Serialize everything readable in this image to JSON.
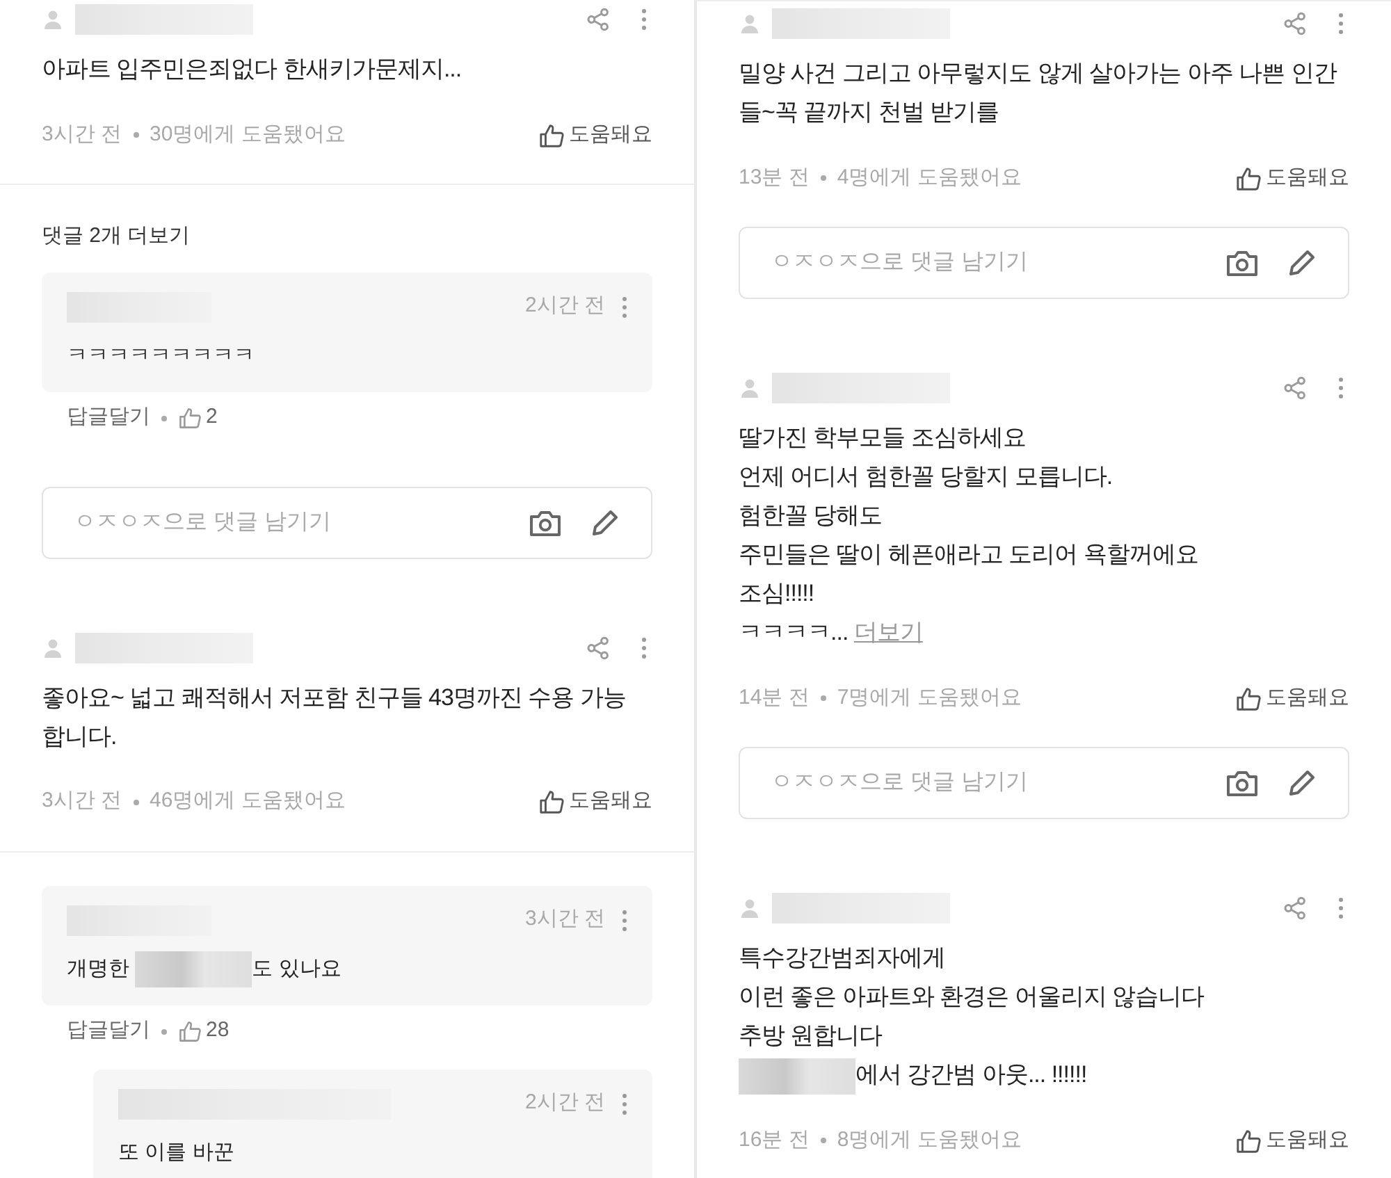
{
  "columns": [
    {
      "sections": [
        {
          "post": {
            "lines": [
              "아파트 입주민은죄없다 한새키가문제지..."
            ],
            "time": "3시간 전",
            "helped": "30명에게 도움됐어요",
            "help_button": "도움돼요"
          },
          "more_comments": "댓글 2개 더보기",
          "replies": [
            {
              "time": "2시간 전",
              "lines": [
                "ㅋㅋㅋㅋㅋㅋㅋㅋㅋ"
              ],
              "reply_link": "답글달기",
              "likes": "2"
            }
          ],
          "comment_input": {
            "placeholder": "ㅇㅈㅇㅈ으로 댓글 남기기"
          }
        },
        {
          "post": {
            "lines": [
              "좋아요~ 넓고 쾌적해서 저포함 친구들 43명까진 수용 가능",
              "합니다."
            ],
            "time": "3시간 전",
            "helped": "46명에게 도움됐어요",
            "help_button": "도움돼요"
          },
          "replies": [
            {
              "time": "3시간 전",
              "lines": [
                {
                  "parts": [
                    {
                      "text": "개명한 "
                    },
                    {
                      "kind": "blur"
                    },
                    {
                      "text": "도 있나요"
                    }
                  ]
                }
              ],
              "reply_link": "답글달기",
              "likes": "28",
              "children": [
                {
                  "time": "2시간 전",
                  "lines": [
                    "또 이를 바꾼"
                  ]
                }
              ]
            }
          ]
        }
      ]
    },
    {
      "sections": [
        {
          "post": {
            "lines": [
              "밀양 사건 그리고 아무렇지도 않게 살아가는 아주 나쁜 인간",
              "들~꼭 끝까지 천벌 받기를"
            ],
            "time": "13분 전",
            "helped": "4명에게 도움됐어요",
            "help_button": "도움돼요"
          },
          "comment_input": {
            "placeholder": "ㅇㅈㅇㅈ으로 댓글 남기기"
          }
        },
        {
          "post": {
            "lines": [
              "딸가진 학부모들 조심하세요",
              "언제 어디서 험한꼴 당할지 모릅니다.",
              "험한꼴 당해도",
              "주민들은 딸이 헤픈애라고 도리어 욕할꺼에요",
              "조심!!!!!",
              "ㅋㅋㅋㅋ..."
            ],
            "more_link": "더보기",
            "time": "14분 전",
            "helped": "7명에게 도움됐어요",
            "help_button": "도움돼요"
          },
          "comment_input": {
            "placeholder": "ㅇㅈㅇㅈ으로 댓글 남기기"
          }
        },
        {
          "post": {
            "lines": [
              "특수강간범죄자에게",
              "이런 좋은 아파트와 환경은 어울리지 않습니다",
              "추방 원합니다",
              {
                "parts": [
                  {
                    "kind": "blur"
                  },
                  {
                    "text": "에서 강간범 아웃... !!!!!!"
                  }
                ]
              }
            ],
            "time": "16분 전",
            "helped": "8명에게 도움됐어요",
            "help_button": "도움돼요"
          }
        }
      ]
    }
  ]
}
